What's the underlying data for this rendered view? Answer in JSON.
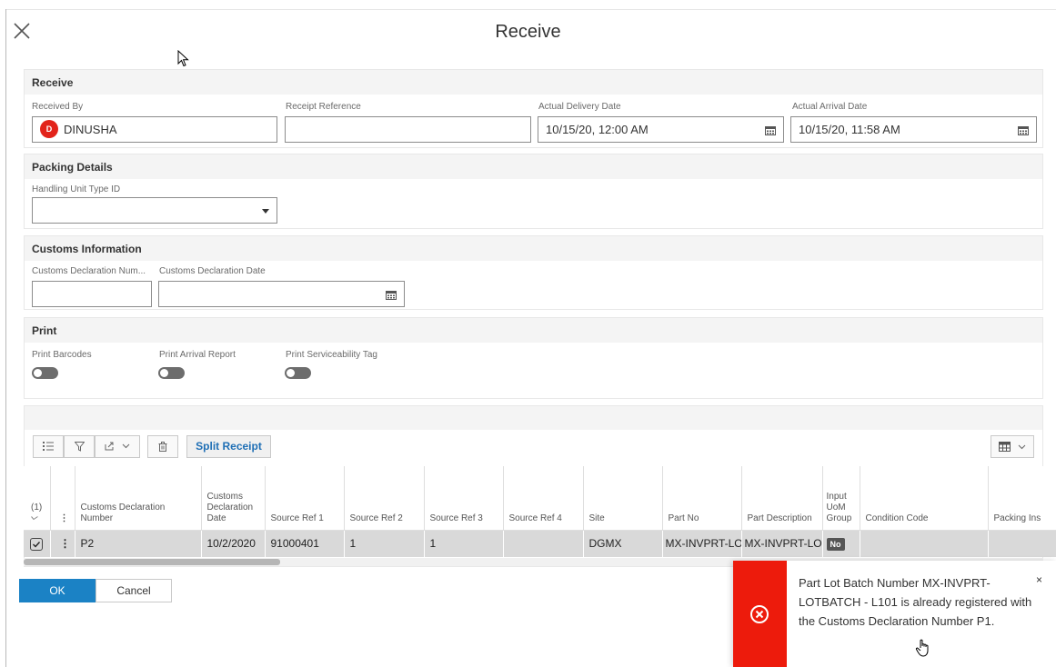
{
  "dialog": {
    "title": "Receive"
  },
  "receive_section": {
    "header": "Receive",
    "received_by": {
      "label": "Received By",
      "avatar_letter": "D",
      "value": "DINUSHA"
    },
    "receipt_reference": {
      "label": "Receipt Reference",
      "value": ""
    },
    "actual_delivery_date": {
      "label": "Actual Delivery Date",
      "value": "10/15/20, 12:00 AM"
    },
    "actual_arrival_date": {
      "label": "Actual Arrival Date",
      "value": "10/15/20, 11:58 AM"
    }
  },
  "packing_section": {
    "header": "Packing Details",
    "handling_unit_type": {
      "label": "Handling Unit Type ID",
      "value": ""
    }
  },
  "customs_section": {
    "header": "Customs Information",
    "declaration_number": {
      "label": "Customs Declaration Num...",
      "value": ""
    },
    "declaration_date": {
      "label": "Customs Declaration Date",
      "value": ""
    }
  },
  "print_section": {
    "header": "Print",
    "toggles": [
      {
        "label": "Print Barcodes",
        "on": false
      },
      {
        "label": "Print Arrival Report",
        "on": false
      },
      {
        "label": "Print Serviceability Tag",
        "on": false
      }
    ]
  },
  "toolbar": {
    "split_receipt": "Split Receipt"
  },
  "grid": {
    "select_count": "(1)",
    "columns": [
      "Customs Declaration Number",
      "Customs Declaration Date",
      "Source Ref 1",
      "Source Ref 2",
      "Source Ref 3",
      "Source Ref 4",
      "Site",
      "Part No",
      "Part Description",
      "Input UoM Group",
      "Condition Code",
      "Packing Ins"
    ],
    "row": {
      "customs_declaration_number": "P2",
      "customs_declaration_date": "10/2/2020",
      "source_ref_1": "91000401",
      "source_ref_2": "1",
      "source_ref_3": "1",
      "source_ref_4": "",
      "site": "DGMX",
      "part_no": "MX-INVPRT-LO",
      "part_description": "MX-INVPRT-LO",
      "input_uom_group": "No",
      "condition_code": "",
      "packing_ins": ""
    }
  },
  "footer": {
    "ok": "OK",
    "cancel": "Cancel"
  },
  "toast": {
    "message": "Part Lot Batch Number MX-INVPRT-LOTBATCH - L101 is already registered with the Customs Declaration Number P1.",
    "close": "×",
    "color": "#ed1b0c"
  },
  "colors": {
    "primary": "#1b82c5",
    "error": "#ed1b0c",
    "avatar": "#e2231a"
  }
}
